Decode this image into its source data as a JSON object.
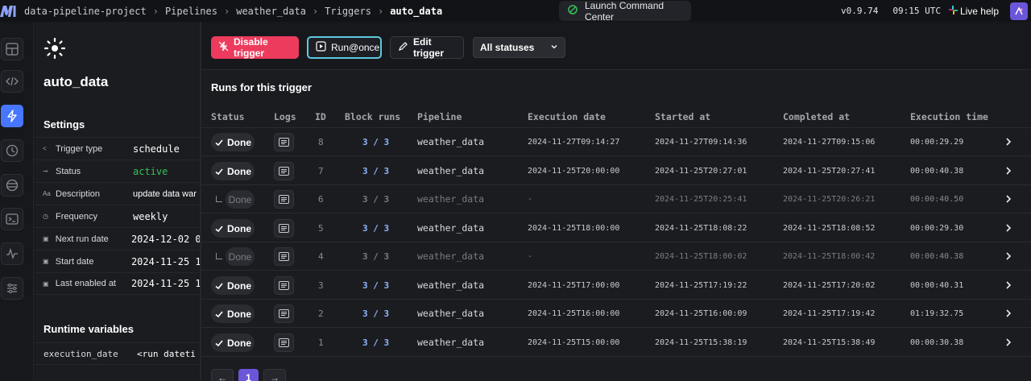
{
  "topbar": {
    "breadcrumbs": [
      "data-pipeline-project",
      "Pipelines",
      "weather_data",
      "Triggers",
      "auto_data"
    ],
    "command_center": "Launch Command Center",
    "version": "v0.9.74",
    "time": "09:15 UTC",
    "live_help": "Live help"
  },
  "rail": {
    "items": [
      "layout-icon",
      "code-icon",
      "lightning-icon",
      "clock-icon",
      "disk-icon",
      "terminal-icon",
      "pulse-icon",
      "sliders-icon"
    ],
    "active": "lightning-icon"
  },
  "panel": {
    "title": "auto_data",
    "settings_heading": "Settings",
    "settings": [
      {
        "label": "Trigger type",
        "value": "schedule"
      },
      {
        "label": "Status",
        "value": "active"
      },
      {
        "label": "Description",
        "value": "update data war"
      },
      {
        "label": "Frequency",
        "value": "weekly"
      },
      {
        "label": "Next run date",
        "value": "2024-12-02 0"
      },
      {
        "label": "Start date",
        "value": "2024-11-25 1"
      },
      {
        "label": "Last enabled at",
        "value": "2024-11-25 1"
      }
    ],
    "runtime_heading": "Runtime variables",
    "runtime": {
      "key": "execution_date",
      "value": "<run dateti"
    }
  },
  "toolbar": {
    "disable_label": "Disable trigger",
    "run_once_label": "Run@once",
    "edit_label": "Edit trigger",
    "status_filter": "All statuses"
  },
  "runs": {
    "title": "Runs for this trigger",
    "columns": [
      "Status",
      "Logs",
      "ID",
      "Block runs",
      "Pipeline",
      "Execution date",
      "Started at",
      "Completed at",
      "Execution time"
    ],
    "rows": [
      {
        "status": "Done",
        "id": "8",
        "blocks": "3 / 3",
        "pipeline": "weather_data",
        "exec_date": "2024-11-27T09:14:27",
        "started": "2024-11-27T09:14:36",
        "completed": "2024-11-27T09:15:06",
        "duration": "00:00:29.29",
        "retry": false
      },
      {
        "status": "Done",
        "id": "7",
        "blocks": "3 / 3",
        "pipeline": "weather_data",
        "exec_date": "2024-11-25T20:00:00",
        "started": "2024-11-25T20:27:01",
        "completed": "2024-11-25T20:27:41",
        "duration": "00:00:40.38",
        "retry": false
      },
      {
        "status": "Done",
        "id": "6",
        "blocks": "3 / 3",
        "pipeline": "weather_data",
        "exec_date": "-",
        "started": "2024-11-25T20:25:41",
        "completed": "2024-11-25T20:26:21",
        "duration": "00:00:40.50",
        "retry": true
      },
      {
        "status": "Done",
        "id": "5",
        "blocks": "3 / 3",
        "pipeline": "weather_data",
        "exec_date": "2024-11-25T18:00:00",
        "started": "2024-11-25T18:08:22",
        "completed": "2024-11-25T18:08:52",
        "duration": "00:00:29.30",
        "retry": false
      },
      {
        "status": "Done",
        "id": "4",
        "blocks": "3 / 3",
        "pipeline": "weather_data",
        "exec_date": "-",
        "started": "2024-11-25T18:00:02",
        "completed": "2024-11-25T18:00:42",
        "duration": "00:00:40.38",
        "retry": true
      },
      {
        "status": "Done",
        "id": "3",
        "blocks": "3 / 3",
        "pipeline": "weather_data",
        "exec_date": "2024-11-25T17:00:00",
        "started": "2024-11-25T17:19:22",
        "completed": "2024-11-25T17:20:02",
        "duration": "00:00:40.31",
        "retry": false
      },
      {
        "status": "Done",
        "id": "2",
        "blocks": "3 / 3",
        "pipeline": "weather_data",
        "exec_date": "2024-11-25T16:00:00",
        "started": "2024-11-25T16:00:09",
        "completed": "2024-11-25T17:19:42",
        "duration": "01:19:32.75",
        "retry": false
      },
      {
        "status": "Done",
        "id": "1",
        "blocks": "3 / 3",
        "pipeline": "weather_data",
        "exec_date": "2024-11-25T15:00:00",
        "started": "2024-11-25T15:38:19",
        "completed": "2024-11-25T15:38:49",
        "duration": "00:00:30.38",
        "retry": false
      }
    ]
  },
  "pager": {
    "current": "1"
  },
  "colors": {
    "accent": "#4877ff",
    "danger": "#ec3b5d",
    "active_green": "#35c255",
    "focus_ring": "#5ec8de",
    "page_active": "#6b55d9"
  }
}
